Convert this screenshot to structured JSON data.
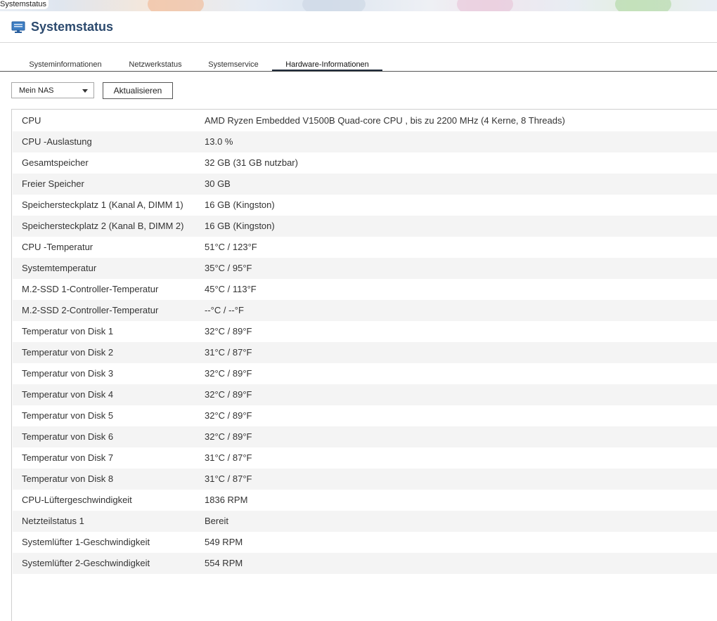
{
  "window": {
    "title": "Systemstatus"
  },
  "header": {
    "title": "Systemstatus",
    "icon": "monitor-icon"
  },
  "tabs": [
    {
      "label": "Systeminformationen",
      "active": false
    },
    {
      "label": "Netzwerkstatus",
      "active": false
    },
    {
      "label": "Systemservice",
      "active": false
    },
    {
      "label": "Hardware-Informationen",
      "active": true
    }
  ],
  "toolbar": {
    "device_select": {
      "value": "Mein NAS"
    },
    "refresh_label": "Aktualisieren"
  },
  "hardware": [
    {
      "label": "CPU",
      "value": "AMD Ryzen Embedded V1500B Quad-core CPU , bis zu 2200 MHz (4 Kerne, 8 Threads)"
    },
    {
      "label": "CPU -Auslastung",
      "value": "13.0 %"
    },
    {
      "label": "Gesamtspeicher",
      "value": "32 GB (31 GB nutzbar)"
    },
    {
      "label": "Freier Speicher",
      "value": "30 GB"
    },
    {
      "label": "Speichersteckplatz 1 (Kanal A, DIMM 1)",
      "value": "16 GB (Kingston)"
    },
    {
      "label": "Speichersteckplatz 2 (Kanal B, DIMM 2)",
      "value": "16 GB (Kingston)"
    },
    {
      "label": "CPU -Temperatur",
      "value": "51°C / 123°F"
    },
    {
      "label": "Systemtemperatur",
      "value": "35°C / 95°F"
    },
    {
      "label": "M.2-SSD 1-Controller-Temperatur",
      "value": "45°C / 113°F"
    },
    {
      "label": "M.2-SSD 2-Controller-Temperatur",
      "value": "--°C / --°F"
    },
    {
      "label": "Temperatur von Disk 1",
      "value": "32°C / 89°F"
    },
    {
      "label": "Temperatur von Disk 2",
      "value": "31°C / 87°F"
    },
    {
      "label": "Temperatur von Disk 3",
      "value": "32°C / 89°F"
    },
    {
      "label": "Temperatur von Disk 4",
      "value": "32°C / 89°F"
    },
    {
      "label": "Temperatur von Disk 5",
      "value": "32°C / 89°F"
    },
    {
      "label": "Temperatur von Disk 6",
      "value": "32°C / 89°F"
    },
    {
      "label": "Temperatur von Disk 7",
      "value": "31°C / 87°F"
    },
    {
      "label": "Temperatur von Disk 8",
      "value": "31°C / 87°F"
    },
    {
      "label": "CPU-Lüftergeschwindigkeit",
      "value": "1836 RPM"
    },
    {
      "label": "Netzteilstatus 1",
      "value": "Bereit"
    },
    {
      "label": "Systemlüfter 1-Geschwindigkeit",
      "value": "549 RPM"
    },
    {
      "label": "Systemlüfter 2-Geschwindigkeit",
      "value": "554 RPM"
    }
  ]
}
